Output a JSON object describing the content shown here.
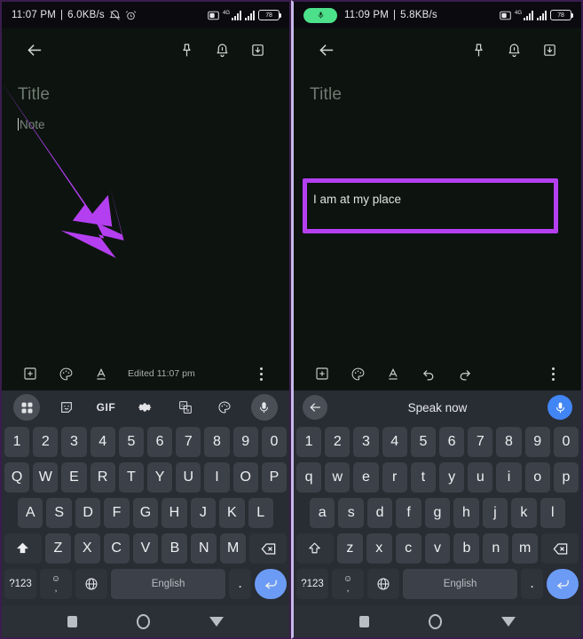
{
  "panels": [
    {
      "id": "before",
      "status": {
        "time": "11:07 PM",
        "separator": "|",
        "datarate": "6.0KB/s",
        "network": "4G",
        "battery": "78",
        "icons": [
          "silent-icon",
          "alarm-icon",
          "sim-icon",
          "signal-icon",
          "signal2-icon",
          "battery-icon"
        ],
        "mic_pill": false
      },
      "appbar": {
        "back": "back-arrow-icon",
        "actions": [
          "pin-icon",
          "reminder-bell-icon",
          "archive-icon"
        ]
      },
      "note": {
        "title_placeholder": "Title",
        "body_placeholder": "Note",
        "body_value": "",
        "caret": true,
        "highlight": false
      },
      "toolbar": {
        "buttons": [
          "add-box-icon",
          "palette-icon",
          "text-format-icon"
        ],
        "edited_label": "Edited 11:07 pm",
        "show_undo_redo": false,
        "overflow": "more-options-icon"
      },
      "keyboard": {
        "mode": "toolbar",
        "toolbar_items": [
          "grid-icon",
          "sticker-icon",
          "GIF",
          "settings-gear-icon",
          "translate-icon",
          "theme-palette-icon",
          "mic-icon"
        ],
        "gif_label": "GIF",
        "highlighted_item": "mic-icon",
        "row_numbers": [
          "1",
          "2",
          "3",
          "4",
          "5",
          "6",
          "7",
          "8",
          "9",
          "0"
        ],
        "row_top": [
          "Q",
          "W",
          "E",
          "R",
          "T",
          "Y",
          "U",
          "I",
          "O",
          "P"
        ],
        "row_mid": [
          "A",
          "S",
          "D",
          "F",
          "G",
          "H",
          "J",
          "K",
          "L"
        ],
        "row_bot": [
          "Z",
          "X",
          "C",
          "V",
          "B",
          "N",
          "M"
        ],
        "shift_active": true,
        "symbols_label": "?123",
        "emoji_label": "emoji-comma-key",
        "globe_label": "language-globe-icon",
        "space_label": "English",
        "period_label": ".",
        "enter_label": "enter-icon",
        "backspace_label": "backspace-icon"
      },
      "navbar": [
        "recents-square-icon",
        "home-circle-icon",
        "back-triangle-icon"
      ],
      "annotation": {
        "arrow": true,
        "arrow_color": "#b43ff0",
        "points_to": "mic-icon"
      }
    },
    {
      "id": "after",
      "status": {
        "time": "11:09 PM",
        "separator": "|",
        "datarate": "5.8KB/s",
        "network": "4G",
        "battery": "78",
        "icons": [
          "sim-icon",
          "signal-icon",
          "signal2-icon",
          "battery-icon"
        ],
        "mic_pill": true
      },
      "appbar": {
        "back": "back-arrow-icon",
        "actions": [
          "pin-icon",
          "reminder-bell-icon",
          "archive-icon"
        ]
      },
      "note": {
        "title_placeholder": "Title",
        "body_placeholder": "Note",
        "body_value": "I am at my place",
        "caret": false,
        "highlight": true,
        "highlight_color": "#b43ff0"
      },
      "toolbar": {
        "buttons": [
          "add-box-icon",
          "palette-icon",
          "text-format-icon"
        ],
        "edited_label": "",
        "show_undo_redo": true,
        "undo": "undo-icon",
        "redo": "redo-icon",
        "overflow": "more-options-icon"
      },
      "keyboard": {
        "mode": "voice",
        "voice_back": "back-arrow-icon",
        "voice_title": "Speak now",
        "voice_mic": "mic-icon",
        "row_numbers": [
          "1",
          "2",
          "3",
          "4",
          "5",
          "6",
          "7",
          "8",
          "9",
          "0"
        ],
        "row_top": [
          "q",
          "w",
          "e",
          "r",
          "t",
          "y",
          "u",
          "i",
          "o",
          "p"
        ],
        "row_mid": [
          "a",
          "s",
          "d",
          "f",
          "g",
          "h",
          "j",
          "k",
          "l"
        ],
        "row_bot": [
          "z",
          "x",
          "c",
          "v",
          "b",
          "n",
          "m"
        ],
        "shift_active": false,
        "symbols_label": "?123",
        "emoji_label": "emoji-comma-key",
        "globe_label": "language-globe-icon",
        "space_label": "English",
        "period_label": ".",
        "enter_label": "enter-icon",
        "backspace_label": "backspace-icon"
      },
      "navbar": [
        "recents-square-icon",
        "home-circle-icon",
        "back-triangle-icon"
      ],
      "annotation": {
        "arrow": false
      }
    }
  ],
  "colors": {
    "annotation": "#b43ff0",
    "note_bg": "#0d1410",
    "keyboard_bg": "#282c33",
    "key_bg": "#3c4048",
    "enter_blue": "#6c9bf5",
    "mic_green": "#4ce08a",
    "voice_mic_blue": "#4285f4",
    "frame_purple": "#3a1d4d"
  }
}
